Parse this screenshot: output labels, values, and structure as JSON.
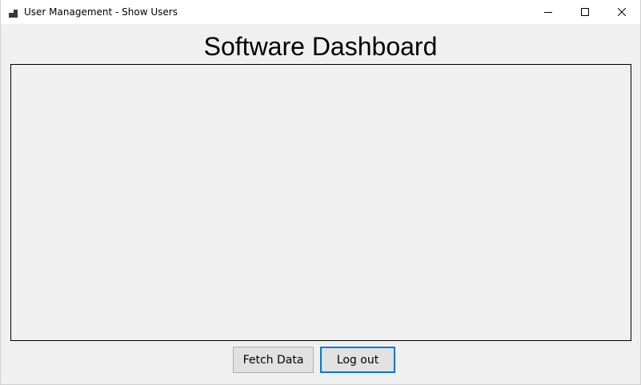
{
  "window": {
    "title": "User Management - Show Users"
  },
  "controls": {
    "minimize_icon": "minimize-icon",
    "maximize_icon": "maximize-icon",
    "close_icon": "close-icon"
  },
  "main": {
    "title": "Software Dashboard",
    "data_panel_content": ""
  },
  "actions": {
    "fetch_label": "Fetch Data",
    "logout_label": "Log out"
  },
  "colors": {
    "window_bg": "#f0f0f0",
    "titlebar_bg": "#ffffff",
    "button_bg": "#e1e1e1",
    "focus_border": "#0078d7"
  }
}
